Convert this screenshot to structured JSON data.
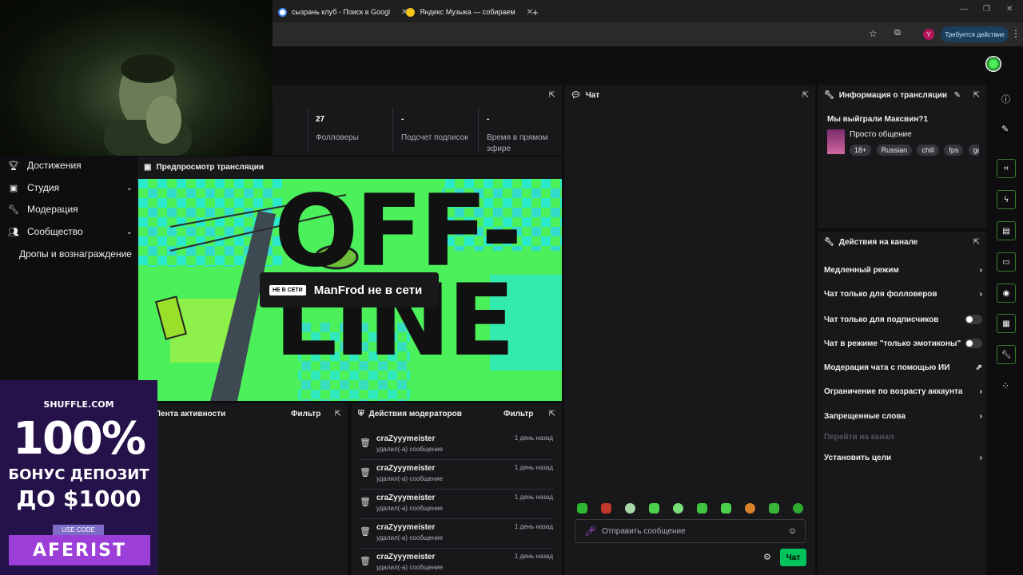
{
  "browser": {
    "tabs": [
      {
        "label": "сызрань клуб - Поиск в Googl"
      },
      {
        "label": "Яндекс Музыка — собираем"
      }
    ],
    "new_tab": "+",
    "action_button": "Требуется действие",
    "avatar_letter": "Y"
  },
  "stats": [
    {
      "value": "27",
      "label": "Фолловеры"
    },
    {
      "value": "-",
      "label": "Подсчет подписок"
    },
    {
      "value": "-",
      "label": "Время в прямом эфире"
    }
  ],
  "sidebar": {
    "items": [
      {
        "label": "Достижения",
        "icon": "trophy-icon"
      },
      {
        "label": "Студия",
        "icon": "studio-icon"
      },
      {
        "label": "Модерация",
        "icon": "wrench-icon"
      },
      {
        "label": "Сообщество",
        "icon": "community-icon"
      }
    ],
    "sub_item": "Дропы и вознаграждение"
  },
  "preview": {
    "title": "Предпросмотр трансляции",
    "offline_text": "OFF-LINE",
    "badge": "НЕ В СЕТИ",
    "status": "ManFrod не в сети"
  },
  "activity": {
    "title": "Лента активности",
    "filter": "Фильтр"
  },
  "mod_actions": {
    "title": "Действия модераторов",
    "filter": "Фильтр",
    "rows": [
      {
        "user": "craZyyymeister",
        "action": "удалил(-а) сообщение",
        "time": "1 день назад"
      },
      {
        "user": "craZyyymeister",
        "action": "удалил(-а) сообщение",
        "time": "1 день назад"
      },
      {
        "user": "craZyyymeister",
        "action": "удалил(-а) сообщение",
        "time": "1 день назад"
      },
      {
        "user": "craZyyymeister",
        "action": "удалил(-а) сообщение",
        "time": "1 день назад"
      },
      {
        "user": "craZyyymeister",
        "action": "удалил(-а) сообщение",
        "time": "1 день назад"
      }
    ]
  },
  "chat": {
    "title": "Чат",
    "placeholder": "Отправить сообщение",
    "send_label": "Чат"
  },
  "stream_info": {
    "title": "Информация о трансляции",
    "stream_title": "Мы выйграли Максвин?1",
    "category": "Просто общение",
    "tags": [
      "18+",
      "Russian",
      "chill",
      "fps",
      "ga"
    ]
  },
  "channel_actions": {
    "title": "Действия на канале",
    "rows": [
      {
        "label": "Медленный режим",
        "control": "chevron"
      },
      {
        "label": "Чат только для фолловеров",
        "control": "chevron"
      },
      {
        "label": "Чат только для подписчиков",
        "control": "toggle"
      },
      {
        "label": "Чат в режиме \"только эмотиконы\"",
        "control": "toggle"
      },
      {
        "label": "Модерация чата с помощью ИИ",
        "control": "external"
      },
      {
        "label": "Ограничение по возрасту аккаунта",
        "control": "chevron"
      },
      {
        "label": "Запрещенные слова",
        "control": "chevron"
      },
      {
        "label": "Перейти на канал",
        "control": "none"
      },
      {
        "label": "Установить цели",
        "control": "chevron"
      }
    ]
  },
  "ad": {
    "brand": "SHUFFLE.COM",
    "headline": "100%",
    "line2": "БОНУС ДЕПОЗИТ",
    "line3": "ДО $1000",
    "use_code": "USE CODE",
    "code": "AFERIST"
  },
  "colors": {
    "accent_green": "#00c35c",
    "neon_green": "#4cf05a",
    "cyan": "#22e6e6",
    "panel": "#18181b",
    "background": "#0e0e10"
  }
}
